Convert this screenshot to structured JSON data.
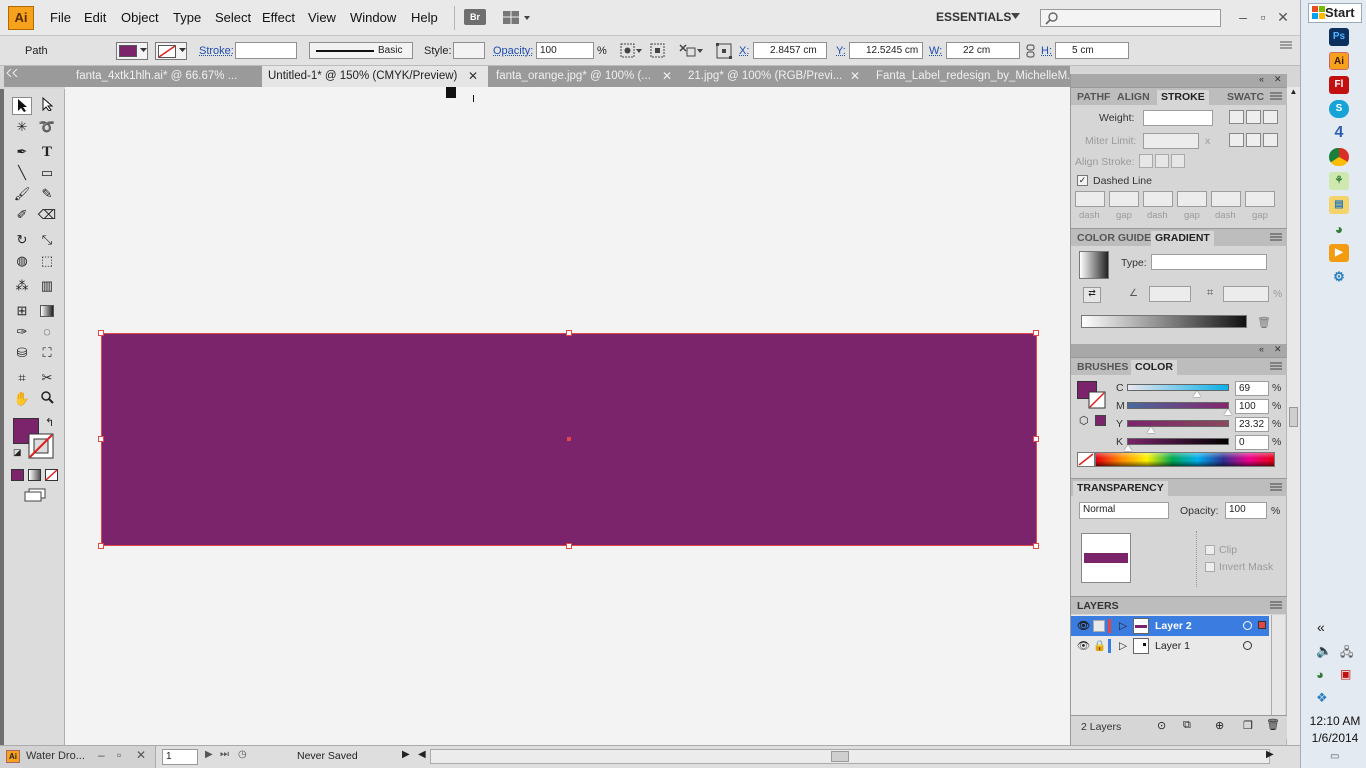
{
  "app": {
    "logo": "Ai",
    "menu": [
      "File",
      "Edit",
      "Object",
      "Type",
      "Select",
      "Effect",
      "View",
      "Window",
      "Help"
    ],
    "bridge_label": "Br",
    "workspace": "ESSENTIALS",
    "search_placeholder": ""
  },
  "control": {
    "selection_type": "Path",
    "stroke_label": "Stroke:",
    "stroke_weight": "",
    "brush_label": "Basic",
    "style_label": "Style:",
    "opacity_label": "Opacity:",
    "opacity_value": "100",
    "opacity_unit": "%",
    "x_label": "X:",
    "x_value": "2.8457 cm",
    "y_label": "Y:",
    "y_value": "12.5245 cm",
    "w_label": "W:",
    "w_value": "22 cm",
    "h_label": "H:",
    "h_value": "5 cm"
  },
  "tabs": [
    {
      "label": "fanta_4xtk1hlh.ai* @ 66.67% ..."
    },
    {
      "label": "Untitled-1* @ 150% (CMYK/Preview)"
    },
    {
      "label": "fanta_orange.jpg* @ 100% (..."
    },
    {
      "label": "21.jpg* @ 100% (RGB/Previ..."
    },
    {
      "label": "Fanta_Label_redesign_by_MichelleM..."
    }
  ],
  "stroke_panel": {
    "tabs": [
      "PATHF",
      "ALIGN",
      "STROKE",
      "SWATC"
    ],
    "weight_label": "Weight:",
    "miter_label": "Miter Limit:",
    "miter_unit": "x",
    "align_label": "Align Stroke:",
    "dashed_label": "Dashed Line",
    "dash_labels": [
      "dash",
      "gap",
      "dash",
      "gap",
      "dash",
      "gap"
    ]
  },
  "gradient_panel": {
    "tabs": [
      "COLOR GUIDE",
      "GRADIENT"
    ],
    "type_label": "Type:",
    "unit": "%"
  },
  "color_panel": {
    "tabs": [
      "BRUSHES",
      "COLOR"
    ],
    "channels": [
      {
        "label": "C",
        "value": "69",
        "unit": "%",
        "level": 0.69,
        "grad": "linear-gradient(to right,#e9e6ee,#0ab0e8)"
      },
      {
        "label": "M",
        "value": "100",
        "unit": "%",
        "level": 1.0,
        "grad": "linear-gradient(to right,#4a6a9c,#86246c)"
      },
      {
        "label": "Y",
        "value": "23.32",
        "unit": "%",
        "level": 0.2332,
        "grad": "linear-gradient(to right,#7b246c,#8a4a5c)"
      },
      {
        "label": "K",
        "value": "0",
        "unit": "%",
        "level": 0.0,
        "grad": "linear-gradient(to right,#7b246c,#000000)"
      }
    ],
    "fill_color": "#7b246c"
  },
  "transparency_panel": {
    "title": "TRANSPARENCY",
    "blend_mode": "Normal",
    "opacity_label": "Opacity:",
    "opacity_value": "100",
    "opacity_unit": "%",
    "clip_label": "Clip",
    "invert_label": "Invert Mask"
  },
  "layers_panel": {
    "title": "LAYERS",
    "layers": [
      {
        "name": "Layer 2",
        "selected": true
      },
      {
        "name": "Layer 1",
        "selected": false
      }
    ],
    "count_label": "2 Layers"
  },
  "status": {
    "taskbar_item": "Water Dro...",
    "page_number": "1",
    "save_status": "Never Saved"
  },
  "taskbar": {
    "start": "Start",
    "time": "12:10 AM",
    "date": "1/6/2014",
    "collapse": "«"
  },
  "colors": {
    "fill": "#7b246c",
    "selection": "#e04848",
    "layer_selected": "#3b7ce0"
  }
}
